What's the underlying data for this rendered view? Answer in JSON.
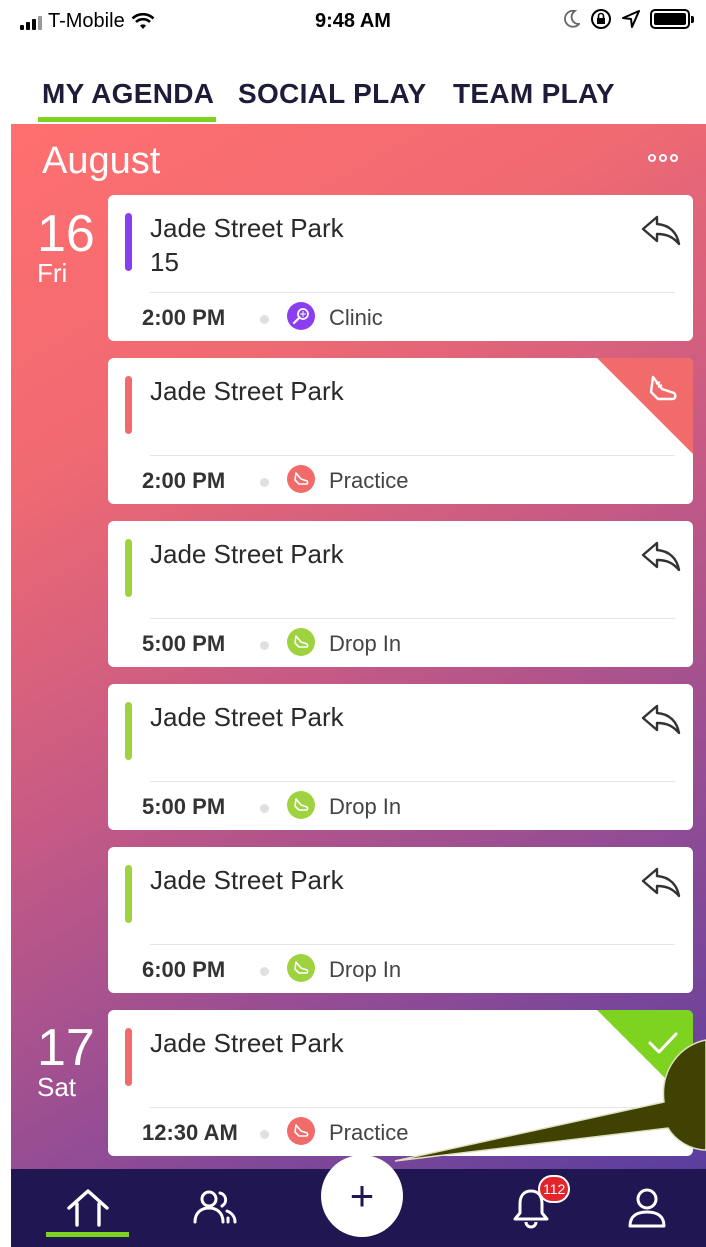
{
  "status_bar": {
    "carrier": "T-Mobile",
    "time": "9:48 AM"
  },
  "tabs": [
    {
      "label": "MY AGENDA",
      "active": true
    },
    {
      "label": "SOCIAL PLAY",
      "active": false
    },
    {
      "label": "TEAM PLAY",
      "active": false
    }
  ],
  "agenda": {
    "month": "August",
    "days": [
      {
        "num": "16",
        "dow": "Fri"
      },
      {
        "num": "17",
        "dow": "Sat"
      }
    ],
    "events": [
      {
        "title": "Jade Street Park",
        "subtitle": "15",
        "time": "2:00 PM",
        "type": "Clinic",
        "bar_color": "#8a3ef0",
        "icon": "tennis-racket-icon",
        "icon_color": "#8a3ef0",
        "status": "share"
      },
      {
        "title": "Jade Street Park",
        "subtitle": "",
        "time": "2:00 PM",
        "type": "Practice",
        "bar_color": "#f26b6b",
        "icon": "sneaker-icon",
        "icon_color": "#f26b6b",
        "status": "practice-flag"
      },
      {
        "title": "Jade Street Park",
        "subtitle": "",
        "time": "5:00 PM",
        "type": "Drop In",
        "bar_color": "#9ed33f",
        "icon": "sneaker-icon",
        "icon_color": "#9ed33f",
        "status": "share"
      },
      {
        "title": "Jade Street Park",
        "subtitle": "",
        "time": "5:00 PM",
        "type": "Drop In",
        "bar_color": "#9ed33f",
        "icon": "sneaker-icon",
        "icon_color": "#9ed33f",
        "status": "share"
      },
      {
        "title": "Jade Street Park",
        "subtitle": "",
        "time": "6:00 PM",
        "type": "Drop In",
        "bar_color": "#9ed33f",
        "icon": "sneaker-icon",
        "icon_color": "#9ed33f",
        "status": "share"
      },
      {
        "title": "Jade Street Park",
        "subtitle": "",
        "time": "12:30 AM",
        "type": "Practice",
        "bar_color": "#f26b6b",
        "icon": "sneaker-icon",
        "icon_color": "#f26b6b",
        "status": "confirmed"
      }
    ]
  },
  "bottom_nav": {
    "notification_count": "112",
    "items": [
      "home-icon",
      "people-icon",
      "add-icon",
      "bell-icon",
      "profile-icon"
    ]
  },
  "colors": {
    "accent_green": "#7ed321",
    "nav_bg": "#1f1652",
    "badge_red": "#e3242b"
  }
}
